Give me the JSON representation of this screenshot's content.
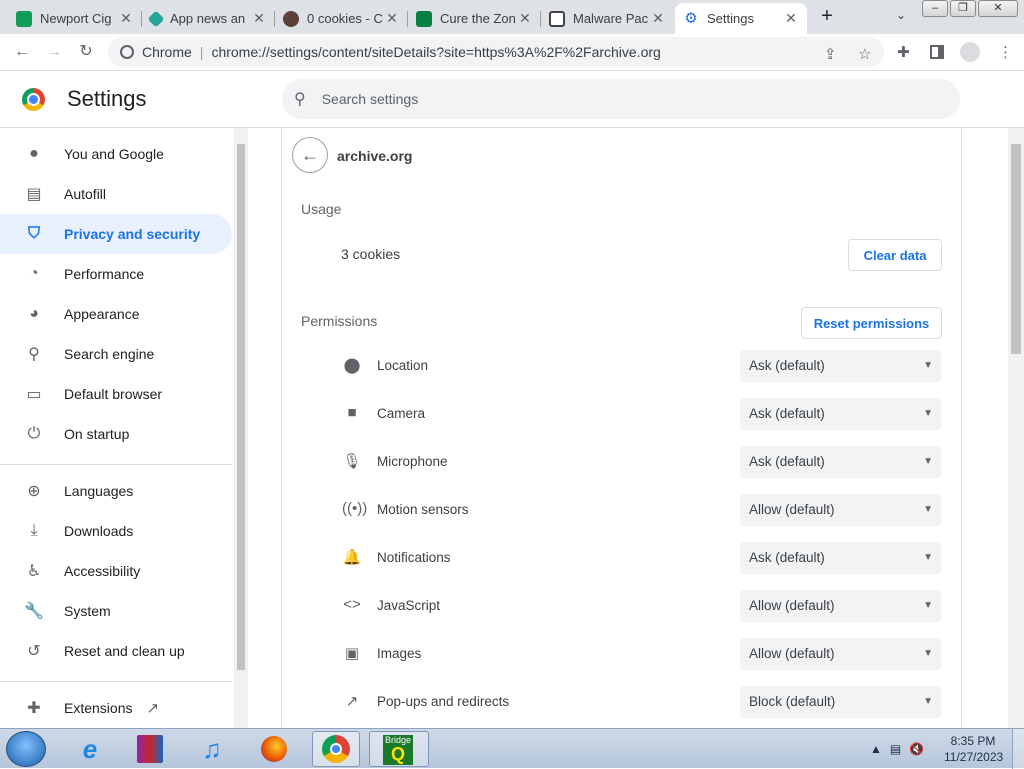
{
  "browser": {
    "tabs": [
      {
        "title": "Newport Cig",
        "favicon_color": "#0f9d58"
      },
      {
        "title": "App news an",
        "favicon_color": "#26a69a"
      },
      {
        "title": "0 cookies - C",
        "favicon_color": "#5d4037"
      },
      {
        "title": "Cure the Zon",
        "favicon_color": "#0b8043"
      },
      {
        "title": "Malware Pac",
        "favicon_color": "#424242"
      },
      {
        "title": "Settings",
        "favicon_color": "#1a73e8",
        "active": true
      }
    ],
    "new_tab_icon": "plus-icon",
    "omnibox": {
      "scheme_label": "Chrome",
      "separator": "|",
      "url": "chrome://settings/content/siteDetails?site=https%3A%2F%2Farchive.org"
    }
  },
  "header": {
    "title": "Settings",
    "search_placeholder": "Search settings"
  },
  "sidebar": {
    "items": [
      {
        "label": "You and Google",
        "icon": "person-icon"
      },
      {
        "label": "Autofill",
        "icon": "clipboard-icon"
      },
      {
        "label": "Privacy and security",
        "icon": "shield-icon",
        "active": true
      },
      {
        "label": "Performance",
        "icon": "speedometer-icon"
      },
      {
        "label": "Appearance",
        "icon": "palette-icon"
      },
      {
        "label": "Search engine",
        "icon": "search-icon"
      },
      {
        "label": "Default browser",
        "icon": "browser-icon"
      },
      {
        "label": "On startup",
        "icon": "power-icon"
      },
      {
        "label": "Languages",
        "icon": "globe-icon"
      },
      {
        "label": "Downloads",
        "icon": "download-icon"
      },
      {
        "label": "Accessibility",
        "icon": "accessibility-icon"
      },
      {
        "label": "System",
        "icon": "wrench-icon"
      },
      {
        "label": "Reset and clean up",
        "icon": "history-icon"
      },
      {
        "label": "Extensions",
        "icon": "puzzle-icon"
      }
    ]
  },
  "site_details": {
    "site": "archive.org",
    "usage_label": "Usage",
    "cookies_text": "3 cookies",
    "clear_data_label": "Clear data",
    "permissions_label": "Permissions",
    "reset_permissions_label": "Reset permissions",
    "permissions": [
      {
        "label": "Location",
        "value": "Ask (default)",
        "icon": "location-pin-icon"
      },
      {
        "label": "Camera",
        "value": "Ask (default)",
        "icon": "camera-icon"
      },
      {
        "label": "Microphone",
        "value": "Ask (default)",
        "icon": "microphone-icon"
      },
      {
        "label": "Motion sensors",
        "value": "Allow (default)",
        "icon": "sensors-icon"
      },
      {
        "label": "Notifications",
        "value": "Ask (default)",
        "icon": "bell-icon"
      },
      {
        "label": "JavaScript",
        "value": "Allow (default)",
        "icon": "code-icon"
      },
      {
        "label": "Images",
        "value": "Allow (default)",
        "icon": "image-icon"
      },
      {
        "label": "Pop-ups and redirects",
        "value": "Block (default)",
        "icon": "open-in-new-icon"
      }
    ]
  },
  "taskbar": {
    "bridge_label": "Bridge",
    "bridge_letter": "Q",
    "time": "8:35 PM",
    "date": "11/27/2023"
  },
  "colors": {
    "accent": "#1a73e8",
    "active_nav_bg": "#e8f0fe"
  }
}
